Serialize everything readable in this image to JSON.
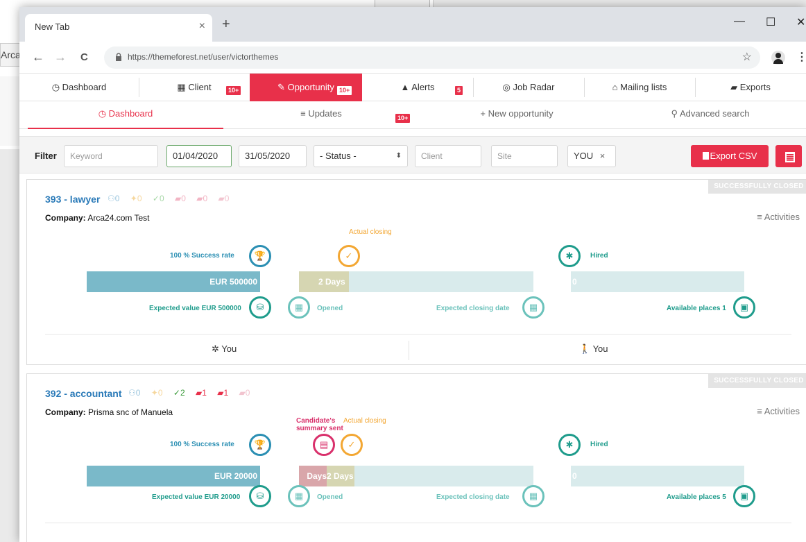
{
  "background_window": {
    "address_partial": "Arca"
  },
  "browser": {
    "tab_title": "New Tab",
    "tab_close": "×",
    "new_tab": "+",
    "minimize": "—",
    "maximize": "☐",
    "close": "✕",
    "back": "←",
    "forward": "→",
    "reload": "C",
    "url": "https://themeforest.net/user/victorthemes",
    "star": "☆",
    "menu": "⋮"
  },
  "mainnav": {
    "items": [
      {
        "label": "Dashboard",
        "icon": "◷"
      },
      {
        "label": "Client",
        "icon": "▦"
      },
      {
        "label": "Opportunity",
        "icon": "✎"
      },
      {
        "label": "Alerts",
        "icon": "▲"
      },
      {
        "label": "Job Radar",
        "icon": "◎"
      },
      {
        "label": "Mailing lists",
        "icon": "⌂"
      },
      {
        "label": "Exports",
        "icon": "▰"
      }
    ],
    "badges": {
      "client": "10+",
      "opportunity": "10+",
      "alerts": "5"
    }
  },
  "subnav": {
    "items": [
      {
        "label": "Dashboard",
        "icon": "◷"
      },
      {
        "label": "Updates",
        "icon": "≡"
      },
      {
        "label": "New opportunity",
        "icon": "+"
      },
      {
        "label": "Advanced search",
        "icon": "⚲"
      }
    ],
    "badges": {
      "updates": "10+"
    }
  },
  "filter": {
    "label": "Filter",
    "keyword_placeholder": "Keyword",
    "date_from": "01/04/2020",
    "date_to": "31/05/2020",
    "status": "- Status -",
    "client_placeholder": "Client",
    "site_placeholder": "Site",
    "user_tag": "YOU",
    "user_tag_remove": "×",
    "export_label": "Export CSV"
  },
  "opportunities": [
    {
      "title": "393 - lawyer",
      "stats": [
        "0",
        "0",
        "0",
        "0",
        "0",
        "0"
      ],
      "company_label": "Company:",
      "company": "Arca24.com Test",
      "status": "SUCCESSFULLY CLOSED",
      "activities": "Activities",
      "success_rate": "100 % Success rate",
      "value_bar": "EUR 500000",
      "expected_value": "Expected value EUR 500000",
      "actual_closing": "Actual closing",
      "days_bar": "2 Days",
      "opened": "Opened",
      "expected_closing": "Expected closing date",
      "hired": "Hired",
      "places_bar": "0",
      "available_places": "Available places 1",
      "foot_left": "You",
      "foot_right": "You"
    },
    {
      "title": "392 - accountant",
      "stats": [
        "0",
        "0",
        "2",
        "1",
        "1",
        "0"
      ],
      "company_label": "Company:",
      "company": "Prisma snc of Manuela",
      "status": "SUCCESSFULLY CLOSED",
      "activities": "Activities",
      "candidate_summary": "Candidate's summary sent",
      "success_rate": "100 % Success rate",
      "value_bar": "EUR 20000",
      "expected_value": "Expected value EUR 20000",
      "actual_closing": "Actual closing",
      "days_bar_a": "Days",
      "days_bar_b": "2 Days",
      "opened": "Opened",
      "expected_closing": "Expected closing date",
      "hired": "Hired",
      "places_bar": "0",
      "available_places": "Available places 5"
    }
  ],
  "colors": {
    "accent": "#e8304a",
    "teal": "#2b8fb3",
    "green_teal": "#1f9c8c",
    "value_bar": "#7ab9c9",
    "days_bar": "#d6d6b2",
    "light_bar": "#d9ebec",
    "orange": "#f3a733",
    "pink": "#d9306b"
  }
}
